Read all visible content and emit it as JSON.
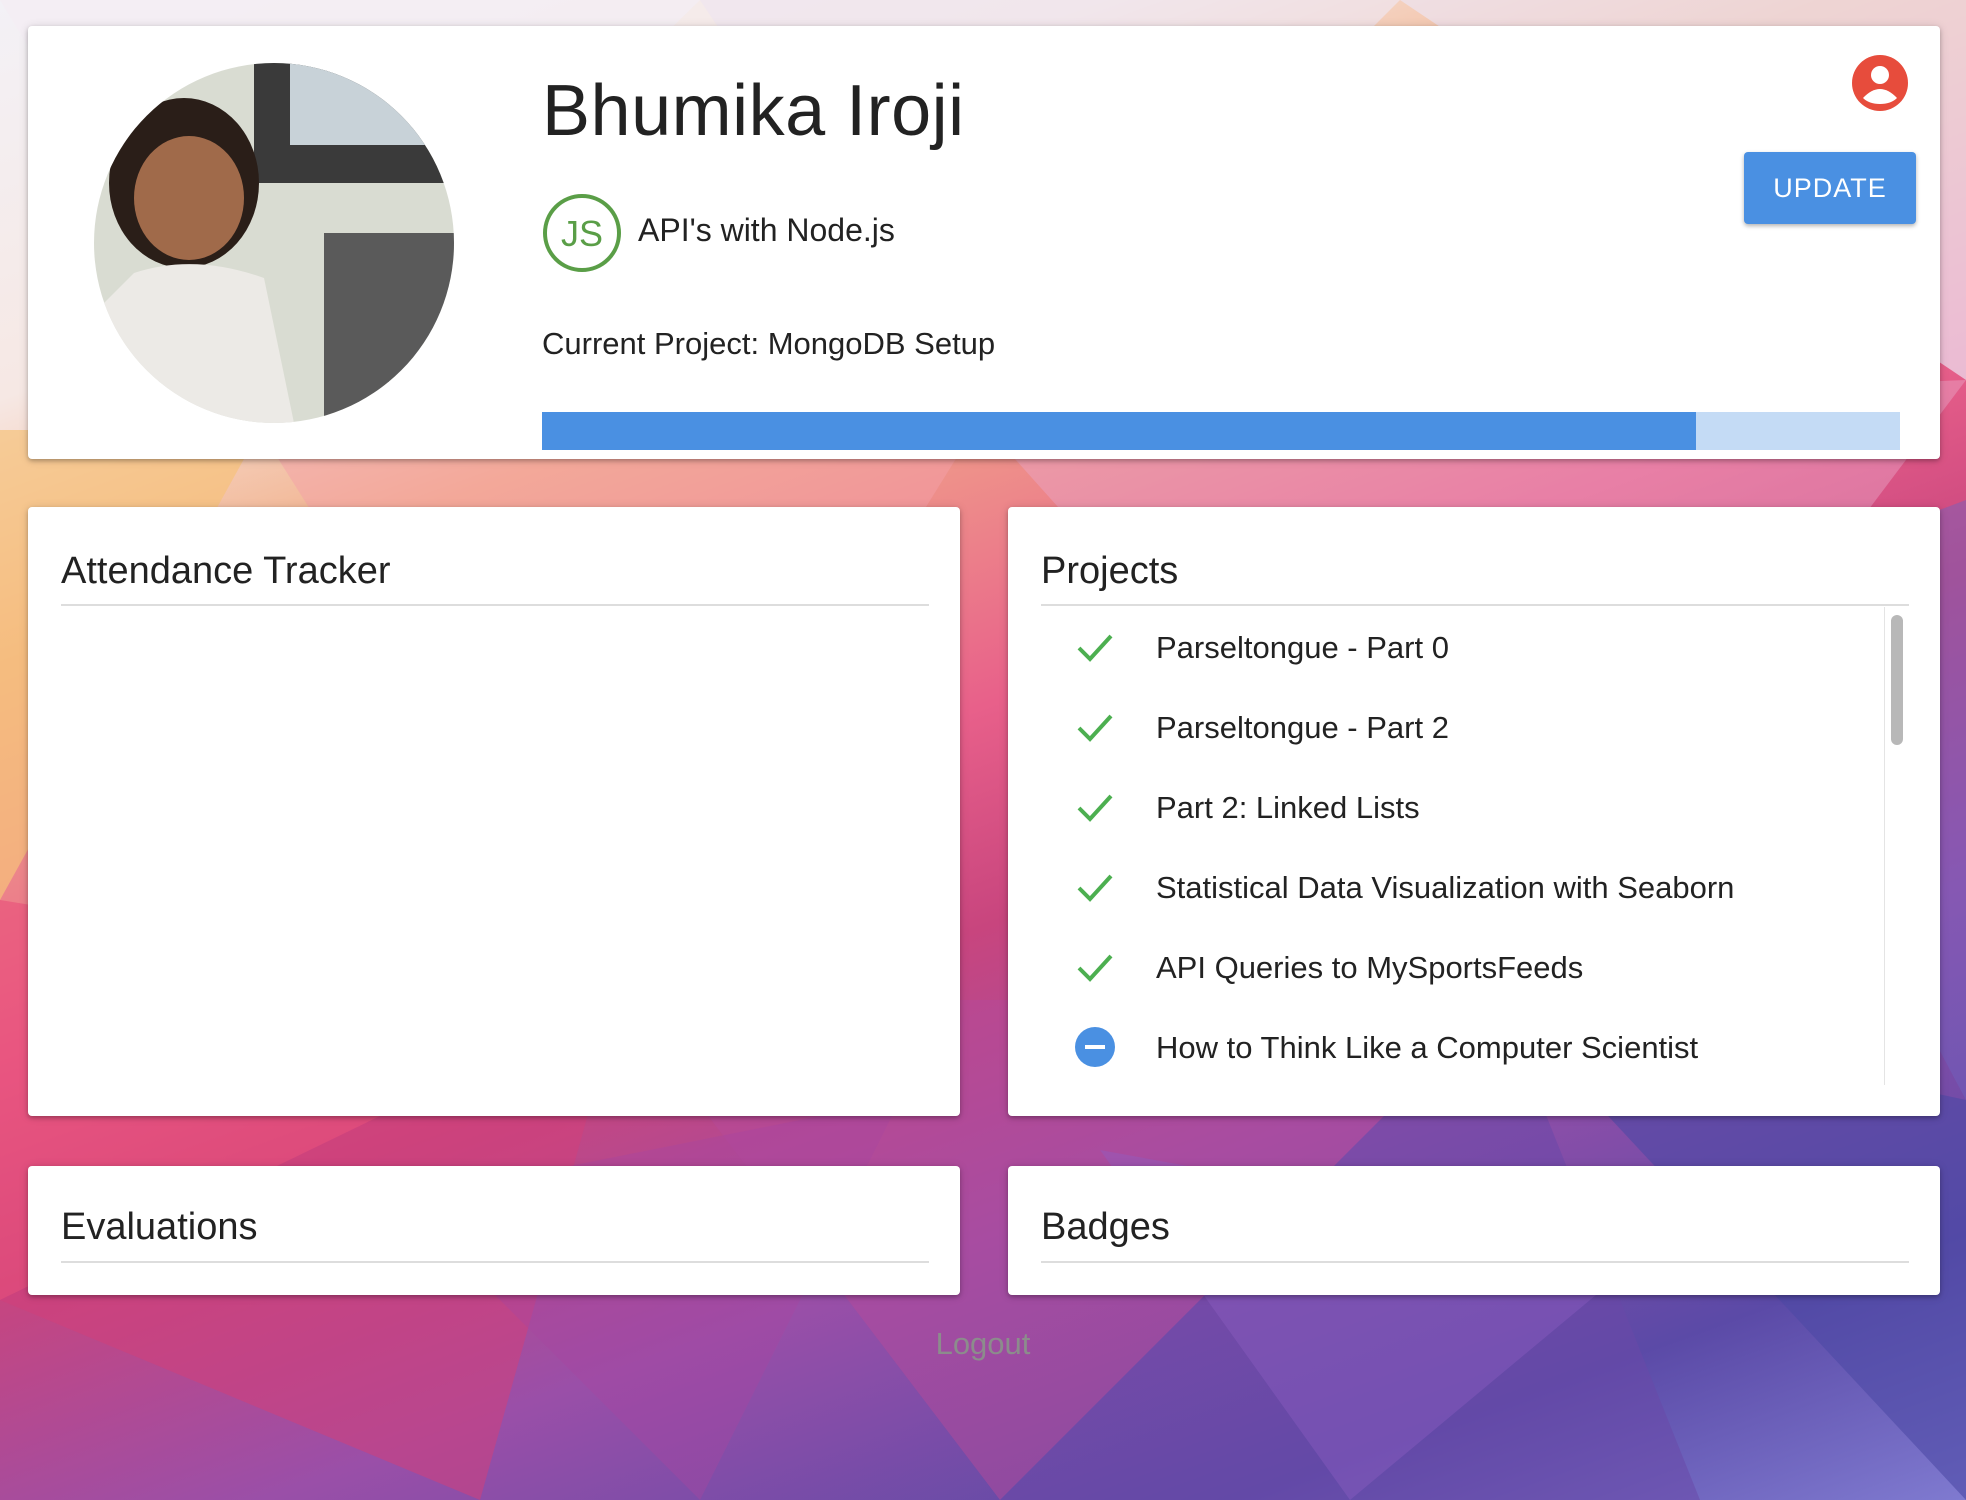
{
  "profile": {
    "name": "Bhumika Iroji",
    "course": {
      "name": "API's with Node.js",
      "logo_text": "JS"
    },
    "current_project": "Current Project: MongoDB Setup",
    "progress": 0.85,
    "update_label": "UPDATE"
  },
  "attendance": {
    "title": "Attendance Tracker"
  },
  "projects": {
    "title": "Projects",
    "items": [
      {
        "label": "Parseltongue - Part 0",
        "status": "complete"
      },
      {
        "label": "Parseltongue - Part 2",
        "status": "complete"
      },
      {
        "label": "Part 2: Linked Lists",
        "status": "complete"
      },
      {
        "label": "Statistical Data Visualization with Seaborn",
        "status": "complete"
      },
      {
        "label": "API Queries to MySportsFeeds",
        "status": "complete"
      },
      {
        "label": "How to Think Like a Computer Scientist",
        "status": "in-progress"
      }
    ]
  },
  "evaluations": {
    "title": "Evaluations"
  },
  "badges": {
    "title": "Badges"
  },
  "logout_label": "Logout",
  "colors": {
    "accent": "#4a90e2",
    "progress_track": "#c4dbf5",
    "check_green": "#4caf50",
    "user_icon_red": "#e74c3c"
  },
  "icons": {
    "user": "account-circle-icon",
    "complete": "checkmark-icon",
    "in_progress": "minus-circle-icon"
  }
}
